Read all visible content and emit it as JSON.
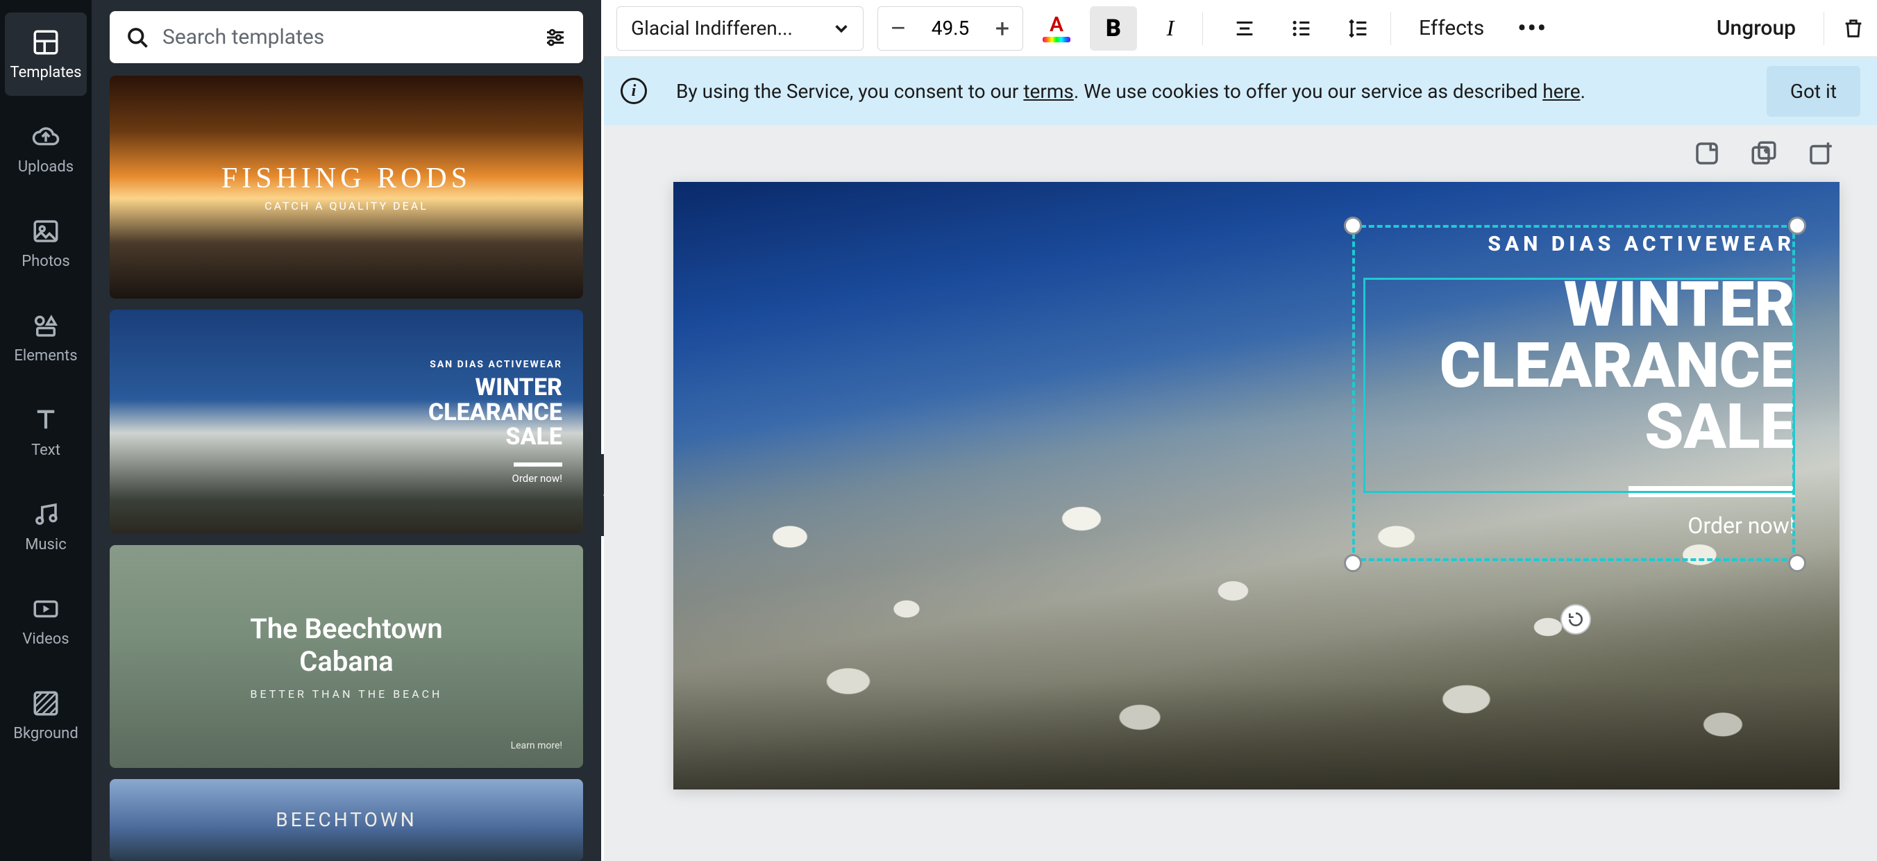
{
  "rail": {
    "items": [
      {
        "label": "Templates"
      },
      {
        "label": "Uploads"
      },
      {
        "label": "Photos"
      },
      {
        "label": "Elements"
      },
      {
        "label": "Text"
      },
      {
        "label": "Music"
      },
      {
        "label": "Videos"
      },
      {
        "label": "Bkground"
      }
    ]
  },
  "search": {
    "placeholder": "Search templates"
  },
  "templates": {
    "t1_title": "FISHING RODS",
    "t1_sub": "CATCH A QUALITY DEAL",
    "t2_brand": "SAN DIAS ACTIVEWEAR",
    "t2_headline": "WINTER\nCLEARANCE\nSALE",
    "t2_cta": "Order now!",
    "t3_title": "The Beechtown\nCabana",
    "t3_sub": "BETTER THAN THE BEACH",
    "t3_link": "Learn more!",
    "t4_title": "BEECHTOWN"
  },
  "toolbar": {
    "font": "Glacial Indifferen...",
    "size": "49.5",
    "effects": "Effects",
    "ungroup": "Ungroup"
  },
  "notice": {
    "prefix": "By using the Service, you consent to our ",
    "terms": "terms",
    "mid": ". We use cookies to offer you our service as described ",
    "here": "here",
    "suffix": ".",
    "gotit": "Got it"
  },
  "canvas": {
    "brand": "SAN DIAS ACTIVEWEAR",
    "line1": "WINTER",
    "line2": "CLEARANCE",
    "line3": "SALE",
    "cta": "Order now!"
  }
}
